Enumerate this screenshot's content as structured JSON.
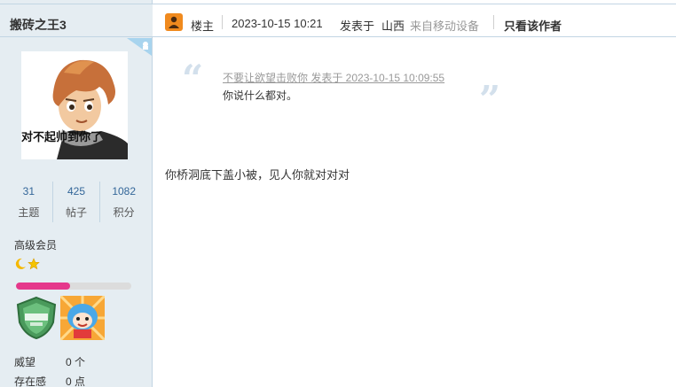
{
  "user": {
    "name": "搬砖之王3",
    "avatar_caption": "对不起帅到你了",
    "stats": [
      {
        "value": "31",
        "label": "主题"
      },
      {
        "value": "425",
        "label": "帖子"
      },
      {
        "value": "1082",
        "label": "积分"
      }
    ],
    "rank": "高级会员",
    "rank_icons": [
      "moon-icon",
      "star-icon"
    ],
    "credit_progress": 0.47,
    "medals": [
      "shield-medal-icon",
      "mascot-medal-icon"
    ],
    "info": [
      {
        "key": "威望",
        "value": "0 个"
      },
      {
        "key": "存在感",
        "value": "0 点"
      }
    ]
  },
  "post": {
    "op_label": "楼主",
    "datetime": "2023-10-15 10:21",
    "posted_in": "发表于",
    "location": "山西",
    "device": "来自移动设备",
    "author_only": "只看该作者",
    "quote": {
      "header": "不要让欲望击败你 发表于 2023-10-15 10:09:55",
      "body": "你说什么都对。"
    },
    "content": "你桥洞底下盖小被，见人你就对对对"
  },
  "colors": {
    "sidebar_bg": "#e5edf2",
    "link_blue": "#336699",
    "credit_fill": "#e5388b",
    "op_icon": "#f08a1e"
  }
}
